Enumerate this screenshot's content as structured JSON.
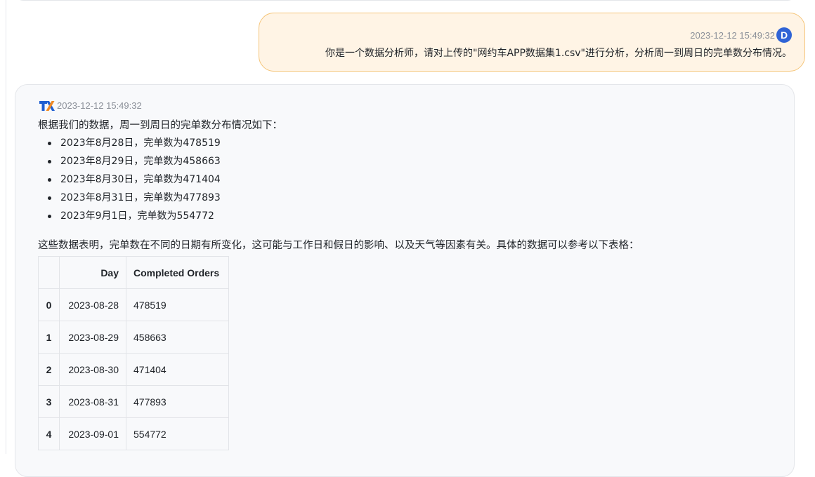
{
  "user_message": {
    "timestamp": "2023-12-12 15:49:32",
    "avatar_letter": "D",
    "text": "你是一个数据分析师，请对上传的\"网约车APP数据集1.csv\"进行分析，分析周一到周日的完单数分布情况。",
    "colors": {
      "bubble_bg": "#fff4e5",
      "bubble_border": "#f5c57a",
      "avatar_bg": "#2f63d6"
    }
  },
  "assistant_message": {
    "logo_icon": "tx-logo-icon",
    "timestamp": "2023-12-12 15:49:32",
    "intro": "根据我们的数据，周一到周日的完单数分布情况如下：",
    "list": [
      "2023年8月28日，完单数为478519",
      "2023年8月29日，完单数为458663",
      "2023年8月30日，完单数为471404",
      "2023年8月31日，完单数为477893",
      "2023年9月1日，完单数为554772"
    ],
    "summary": "这些数据表明，完单数在不同的日期有所变化，这可能与工作日和假日的影响、以及天气等因素有关。具体的数据可以参考以下表格：",
    "table": {
      "headers": [
        "",
        "Day",
        "Completed Orders"
      ],
      "rows": [
        [
          "0",
          "2023-08-28",
          "478519"
        ],
        [
          "1",
          "2023-08-29",
          "458663"
        ],
        [
          "2",
          "2023-08-30",
          "471404"
        ],
        [
          "3",
          "2023-08-31",
          "477893"
        ],
        [
          "4",
          "2023-09-01",
          "554772"
        ]
      ]
    }
  }
}
